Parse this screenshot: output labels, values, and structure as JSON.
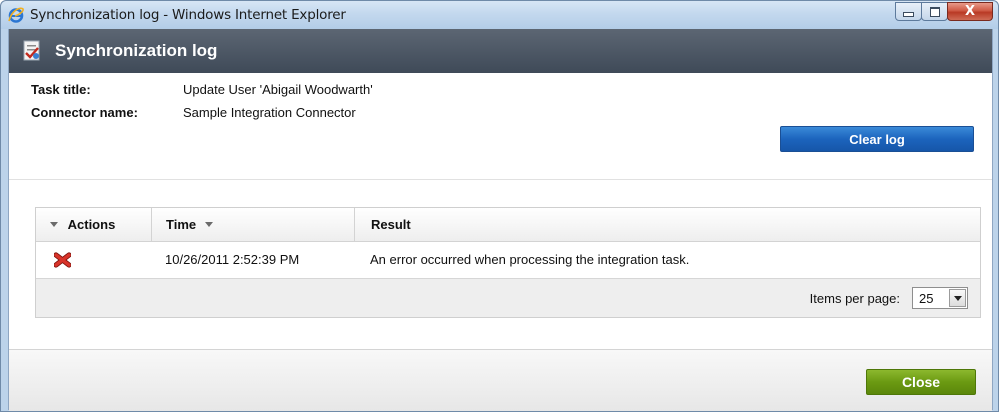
{
  "window": {
    "title": "Synchronization log - Windows Internet Explorer",
    "icon": "internet-explorer-icon",
    "controls": {
      "minimize": "minimize",
      "maximize": "maximize",
      "close_glyph": "X"
    }
  },
  "header": {
    "icon": "synchronization-log-icon",
    "title": "Synchronization log"
  },
  "info": {
    "task_title_label": "Task title:",
    "task_title_value": "Update User 'Abigail Woodwarth'",
    "connector_label": "Connector name:",
    "connector_value": "Sample Integration Connector",
    "clear_button": "Clear log"
  },
  "grid": {
    "columns": [
      {
        "label": "Actions",
        "sort_icon": "dropdown-triangle-icon"
      },
      {
        "label": "Time",
        "sort_icon": "sort-desc-icon"
      },
      {
        "label": "Result"
      }
    ],
    "rows": [
      {
        "action_icon": "delete-x-icon",
        "time": "10/26/2011 2:52:39 PM",
        "result": "An error occurred when processing the integration task."
      }
    ],
    "pager": {
      "items_per_page_label": "Items per page:",
      "items_per_page_value": "25"
    }
  },
  "footer": {
    "close_button": "Close"
  },
  "colors": {
    "header_bg": "#3f4a58",
    "clear_button": "#1c64bd",
    "close_button": "#6b9a12",
    "delete_icon": "#c4261a"
  }
}
